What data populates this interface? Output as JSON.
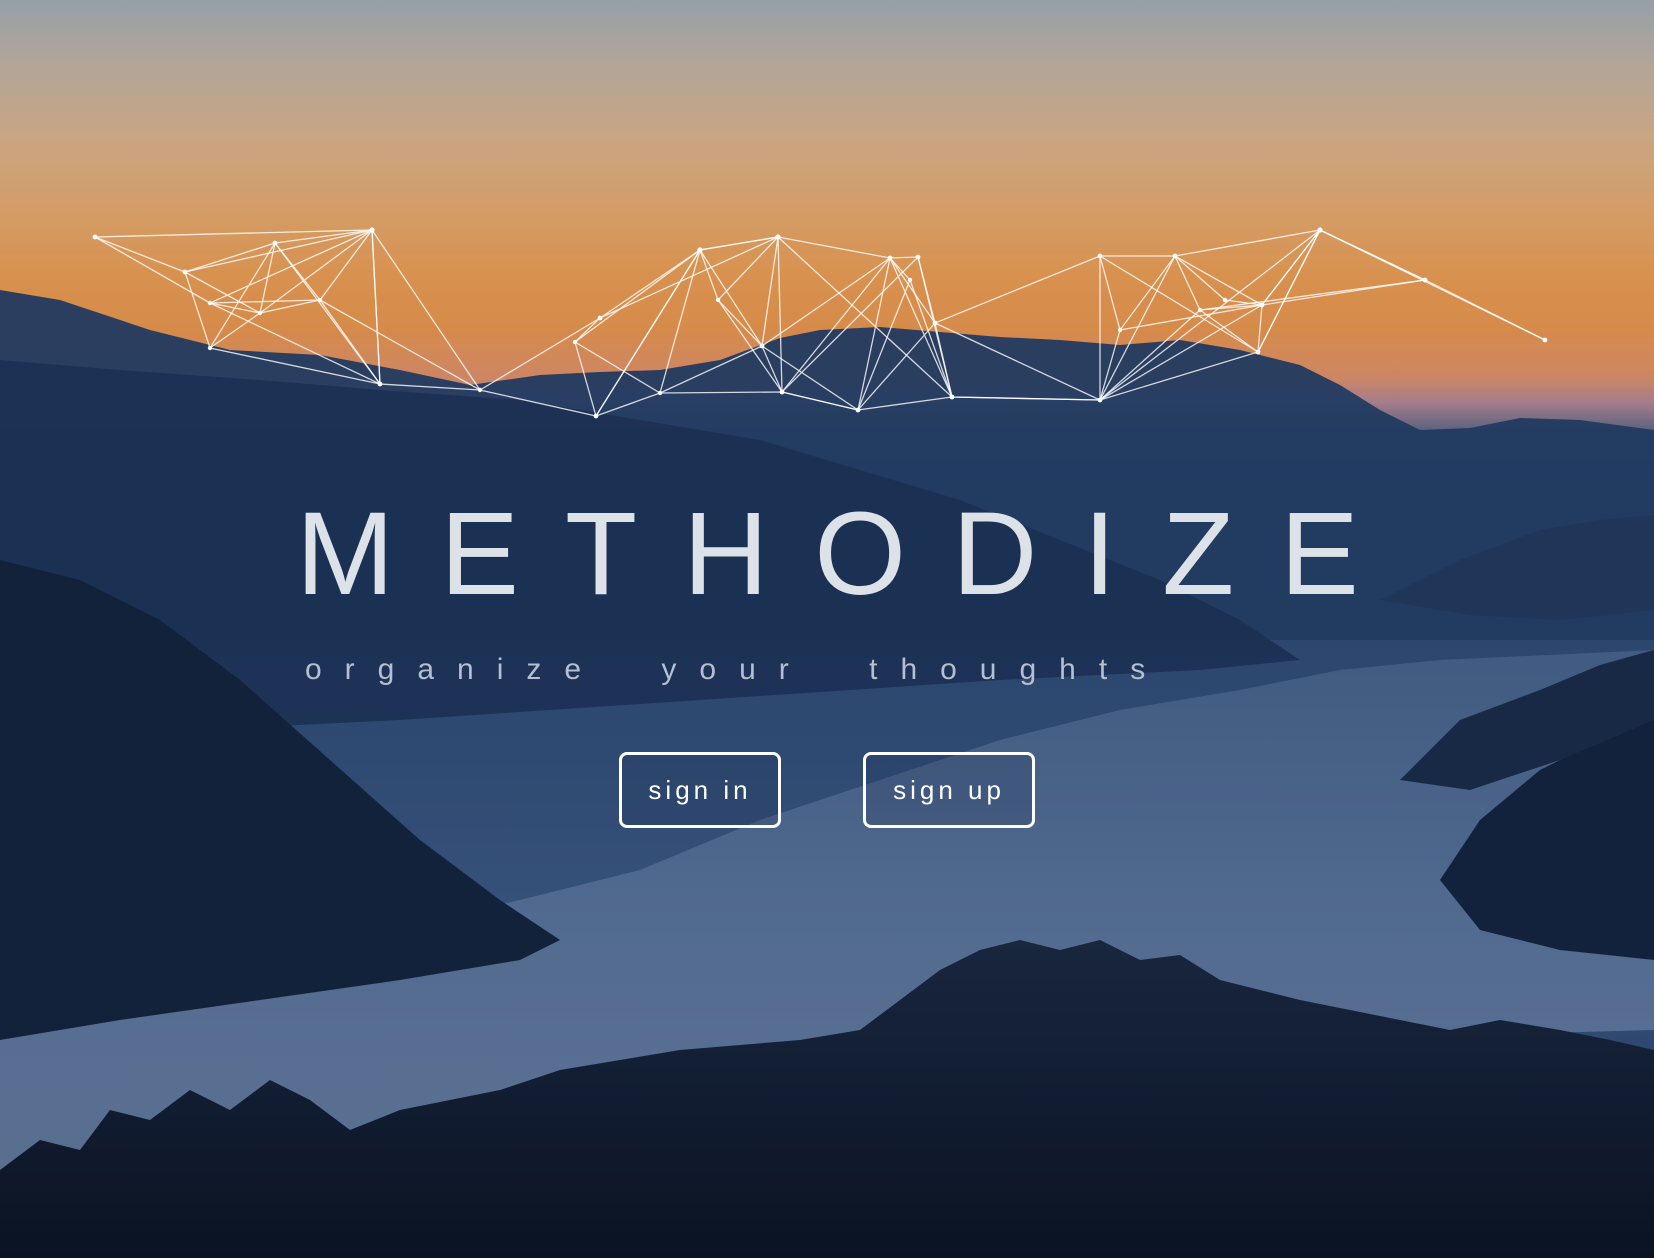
{
  "brand": {
    "title": "METHODIZE",
    "tagline": "organize your thoughts"
  },
  "actions": {
    "sign_in_label": "sign in",
    "sign_up_label": "sign up"
  },
  "background": {
    "scene": "sunset-lake-mountains-photo",
    "overlay": "network-graph-lines",
    "colors": {
      "sky_top": "#a8b2b8",
      "sunset": "#f4a152",
      "mountains": "#1f3558",
      "lake": "#5a7398",
      "trees": "#0d1626",
      "network_lines": "#ffffff"
    }
  }
}
